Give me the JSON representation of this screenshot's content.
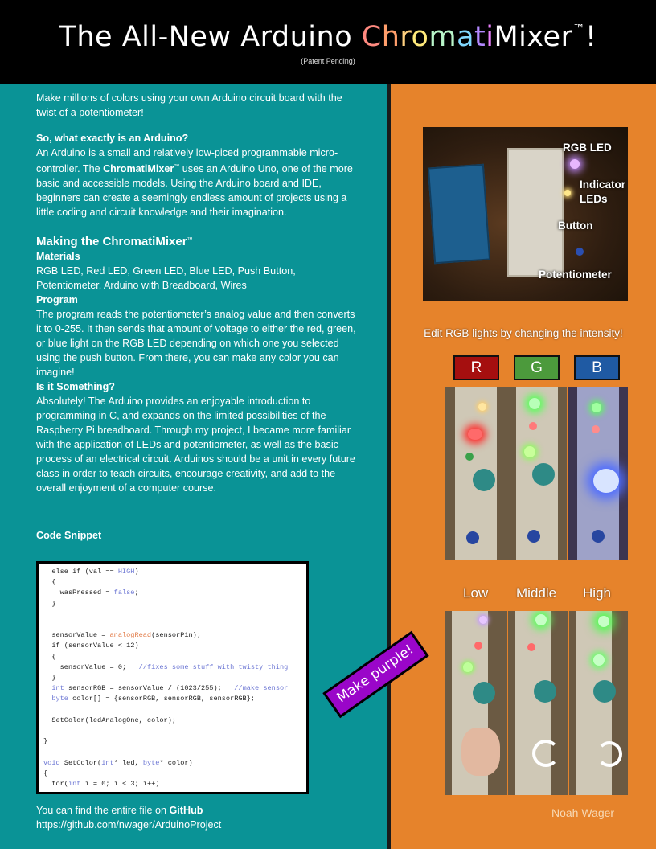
{
  "header": {
    "title_pre": "The All-New Arduino ",
    "title_rainbow": [
      "C",
      "h",
      "r",
      "o",
      "m",
      "a",
      "t",
      "i"
    ],
    "title_post": "Mixer",
    "trademark": "™",
    "title_end": "!",
    "subtitle": "(Patent Pending)"
  },
  "colors": {
    "teal": "#0a9396",
    "orange": "#e6832b",
    "rainbow": [
      "#ff8a80",
      "#ff9e6b",
      "#ffd180",
      "#ffe97a",
      "#b9f6ca",
      "#80d8ff",
      "#b388ff",
      "#ea80fc"
    ]
  },
  "intro": "Make millions of colors using your own Arduino circuit board with the twist of a potentiometer!",
  "what_heading": "So, what exactly is an Arduino?",
  "what_text_1": "An Arduino is a small and relatively low-piced programmable micro-controller. The ",
  "what_brand": "ChromatiMixer",
  "what_text_2": " uses an Arduino Uno, one of the more basic and accessible models. Using the Arduino board and IDE, beginners can create a seemingly endless amount of projects using a little coding and circuit knowledge and their imagination.",
  "making_heading": "Making the ChromatiMixer",
  "materials_heading": "Materials",
  "materials_text": "RGB LED, Red LED, Green LED, Blue LED, Push Button, Potentiometer, Arduino with Breadboard, Wires",
  "program_heading": "Program",
  "program_text": "The program reads the potentiometer’s analog value and then converts it to 0-255. It then sends that amount of voltage to either the red, green, or blue light on the RGB LED depending on which one you selected using the push button. From there, you can make any color you can imagine!",
  "something_heading": "Is it Something?",
  "something_text": "Absolutely! The Arduino provides an enjoyable introduction to programming in C, and expands on the limited possibilities of the Raspberry Pi breadboard. Through my project, I became more familiar with the application of LEDs and potentiometer, as well as the basic process of an electrical circuit. Arduinos should be a unit in every future class in order to teach circuits, encourage creativity, and add to the overall enjoyment of a computer course.",
  "code_heading": "Code Snippet",
  "code_lines": [
    {
      "pre": "  else if (val == ",
      "kw": "HIGH",
      "post": ")"
    },
    {
      "pre": "  {",
      "kw": "",
      "post": ""
    },
    {
      "pre": "    wasPressed = ",
      "kw": "false",
      "post": ";"
    },
    {
      "pre": "  }",
      "kw": "",
      "post": ""
    },
    {
      "pre": "",
      "kw": "",
      "post": ""
    },
    {
      "pre": "",
      "kw": "",
      "post": ""
    },
    {
      "pre": "  sensorValue = ",
      "fn": "analogRead",
      "post": "(sensorPin);"
    },
    {
      "pre": "  if (sensorValue < 12)",
      "kw": "",
      "post": ""
    },
    {
      "pre": "  {",
      "kw": "",
      "post": ""
    },
    {
      "pre": "    sensorValue = 0;   ",
      "cm": "//fixes some stuff with twisty thing",
      "post": ""
    },
    {
      "pre": "  }",
      "kw": "",
      "post": ""
    },
    {
      "kwpre": "  int",
      "pre": " sensorRGB = sensorValue / (1023/255);   ",
      "cm": "//make sensor",
      "post": ""
    },
    {
      "kwpre": "  byte",
      "pre": " color[] = {sensorRGB, sensorRGB, sensorRGB};",
      "post": ""
    },
    {
      "pre": "",
      "kw": "",
      "post": ""
    },
    {
      "pre": "  SetColor(ledAnalogOne, color);",
      "kw": "",
      "post": ""
    },
    {
      "pre": "",
      "kw": "",
      "post": ""
    },
    {
      "pre": "}",
      "kw": "",
      "post": ""
    },
    {
      "pre": "",
      "kw": "",
      "post": ""
    },
    {
      "kwpre": "void",
      "pre": " SetColor(",
      "kw": "int",
      "mid": "* led, ",
      "kw2": "byte",
      "post": "* color)"
    },
    {
      "pre": "{",
      "kw": "",
      "post": ""
    },
    {
      "pre": "  for(",
      "kw": "int",
      "post": " i = 0; i < 3; i++)"
    }
  ],
  "github_text_1": "You can find the entire file on ",
  "github_label": "GitHub",
  "github_url": "https://github.com/nwager/ArduinoProject",
  "callouts": {
    "rgb_led": "RGB LED",
    "indicator_1": "Indicator",
    "indicator_2": "LEDs",
    "button": "Button",
    "potentiometer": "Potentiometer"
  },
  "edit_caption": "Edit RGB lights by changing the intensity!",
  "rgb_buttons": [
    {
      "label": "R",
      "color": "#a50f0f"
    },
    {
      "label": "G",
      "color": "#4c9a3c"
    },
    {
      "label": "B",
      "color": "#1f5aa3"
    }
  ],
  "levels": [
    "Low",
    "Middle",
    "High"
  ],
  "sticker": "Make purple!",
  "author": "Noah Wager"
}
